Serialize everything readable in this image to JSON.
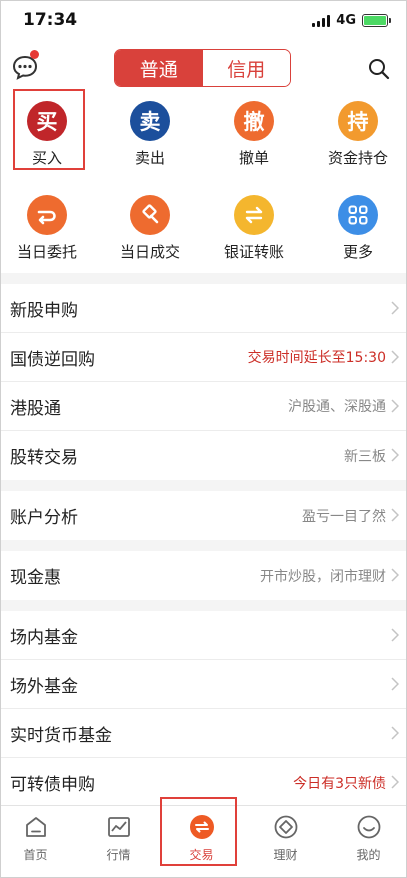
{
  "status": {
    "time": "17:34",
    "network": "4G"
  },
  "header": {
    "tabs": [
      {
        "label": "普通",
        "active": true
      },
      {
        "label": "信用",
        "active": false
      }
    ]
  },
  "actions": [
    {
      "label": "买入",
      "glyph": "买",
      "color": "#c0262a"
    },
    {
      "label": "卖出",
      "glyph": "卖",
      "color": "#1c4f9c"
    },
    {
      "label": "撤单",
      "glyph": "撤",
      "color": "#ee6b2f"
    },
    {
      "label": "资金持仓",
      "glyph": "持",
      "color": "#f29a2e"
    },
    {
      "label": "当日委托",
      "icon": "return-arrow-icon",
      "color": "#ee6b2f"
    },
    {
      "label": "当日成交",
      "icon": "gavel-icon",
      "color": "#ee6b2f"
    },
    {
      "label": "银证转账",
      "icon": "transfer-arrows-icon",
      "color": "#f4b62e"
    },
    {
      "label": "更多",
      "icon": "grid-icon",
      "color": "#3d8ee6"
    }
  ],
  "list_groups": [
    [
      {
        "label": "新股申购",
        "sub": ""
      },
      {
        "label": "国债逆回购",
        "sub": "交易时间延长至15:30",
        "sub_color": "red"
      },
      {
        "label": "港股通",
        "sub": "沪股通、深股通"
      },
      {
        "label": "股转交易",
        "sub": "新三板"
      }
    ],
    [
      {
        "label": "账户分析",
        "sub": "盈亏一目了然"
      }
    ],
    [
      {
        "label": "现金惠",
        "sub": "开市炒股，闭市理财"
      }
    ],
    [
      {
        "label": "场内基金",
        "sub": ""
      },
      {
        "label": "场外基金",
        "sub": ""
      },
      {
        "label": "实时货币基金",
        "sub": ""
      },
      {
        "label": "可转债申购",
        "sub": "今日有3只新债",
        "sub_color": "red"
      }
    ]
  ],
  "tabbar": [
    {
      "label": "首页",
      "icon": "home-icon"
    },
    {
      "label": "行情",
      "icon": "chart-icon"
    },
    {
      "label": "交易",
      "icon": "trade-icon",
      "active": true
    },
    {
      "label": "理财",
      "icon": "finance-icon"
    },
    {
      "label": "我的",
      "icon": "profile-icon"
    }
  ],
  "colors": {
    "brand": "#d9413b",
    "highlight": "#e0403a"
  }
}
